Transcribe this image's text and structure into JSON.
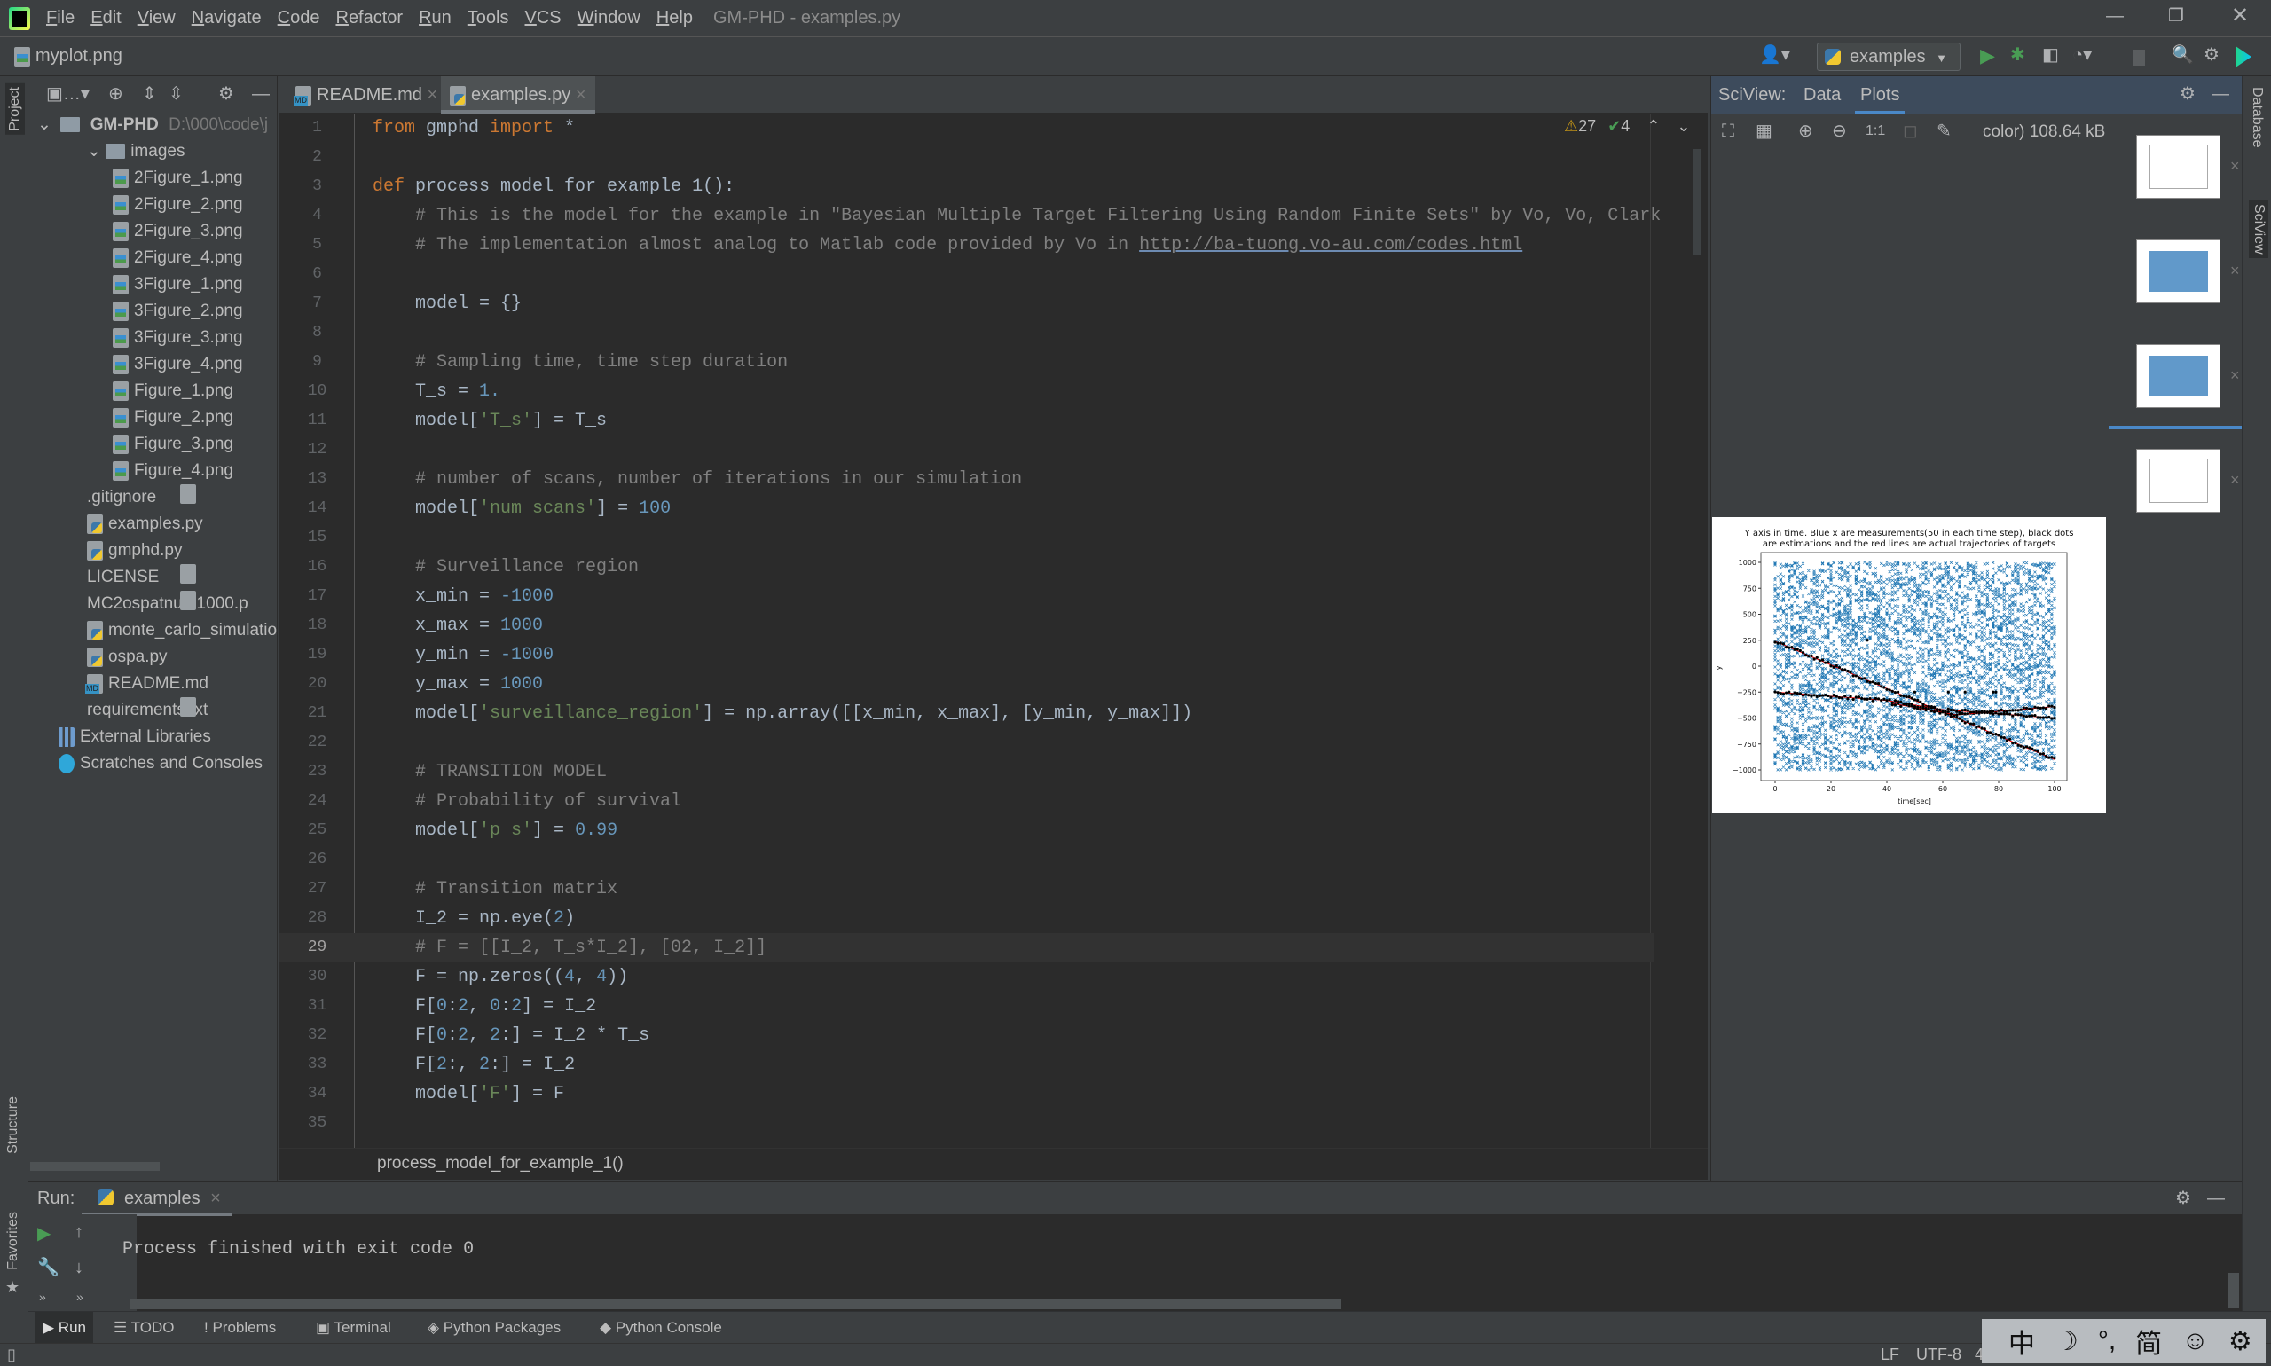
{
  "window": {
    "title": "GM-PHD - examples.py",
    "menu": [
      "File",
      "Edit",
      "View",
      "Navigate",
      "Code",
      "Refactor",
      "Run",
      "Tools",
      "VCS",
      "Window",
      "Help"
    ]
  },
  "navbar": {
    "file": "myplot.png",
    "run_config": "examples"
  },
  "left_strip": {
    "project": "Project",
    "structure": "Structure",
    "favorites": "Favorites"
  },
  "right_strip": {
    "database": "Database",
    "sciview": "SciView"
  },
  "project": {
    "root": {
      "name": "GM-PHD",
      "path": "D:\\000\\code\\j"
    },
    "items": [
      {
        "label": "images",
        "type": "folder",
        "level": 1
      },
      {
        "label": "2Figure_1.png",
        "type": "png",
        "level": 2
      },
      {
        "label": "2Figure_2.png",
        "type": "png",
        "level": 2
      },
      {
        "label": "2Figure_3.png",
        "type": "png",
        "level": 2
      },
      {
        "label": "2Figure_4.png",
        "type": "png",
        "level": 2
      },
      {
        "label": "3Figure_1.png",
        "type": "png",
        "level": 2
      },
      {
        "label": "3Figure_2.png",
        "type": "png",
        "level": 2
      },
      {
        "label": "3Figure_3.png",
        "type": "png",
        "level": 2
      },
      {
        "label": "3Figure_4.png",
        "type": "png",
        "level": 2
      },
      {
        "label": "Figure_1.png",
        "type": "png",
        "level": 2
      },
      {
        "label": "Figure_2.png",
        "type": "png",
        "level": 2
      },
      {
        "label": "Figure_3.png",
        "type": "png",
        "level": 2
      },
      {
        "label": "Figure_4.png",
        "type": "png",
        "level": 2
      },
      {
        "label": ".gitignore",
        "type": "txt",
        "level": 1
      },
      {
        "label": "examples.py",
        "type": "py",
        "level": 1
      },
      {
        "label": "gmphd.py",
        "type": "py",
        "level": 1
      },
      {
        "label": "LICENSE",
        "type": "txt",
        "level": 1
      },
      {
        "label": "MC2ospatnum1000.p",
        "type": "txt",
        "level": 1
      },
      {
        "label": "monte_carlo_simulatio",
        "type": "py",
        "level": 1
      },
      {
        "label": "ospa.py",
        "type": "py",
        "level": 1
      },
      {
        "label": "README.md",
        "type": "md",
        "level": 1
      },
      {
        "label": "requirements.txt",
        "type": "txt",
        "level": 1
      },
      {
        "label": "External Libraries",
        "type": "lib",
        "level": 0
      },
      {
        "label": "Scratches and Consoles",
        "type": "scratch",
        "level": 0
      }
    ]
  },
  "editor": {
    "tabs": [
      {
        "label": "README.md",
        "icon": "md",
        "active": false
      },
      {
        "label": "examples.py",
        "icon": "py",
        "active": true
      }
    ],
    "inspections": {
      "warnings": "27",
      "weak_warnings": "4"
    },
    "current_line": 29,
    "lines": [
      [
        [
          "k",
          "from "
        ],
        [
          "d",
          "gmphd "
        ],
        [
          "k",
          "import "
        ],
        [
          "d",
          "*"
        ]
      ],
      [],
      [
        [
          "k",
          "def "
        ],
        [
          "d",
          "process_model_for_example_1():"
        ]
      ],
      [
        [
          "c",
          "    # This is the model for the example in \"Bayesian Multiple Target Filtering Using Random Finite Sets\" by Vo, Vo, Clark"
        ]
      ],
      [
        [
          "c",
          "    # The implementation almost analog to Matlab code provided by Vo in "
        ],
        [
          "u",
          "http://ba-tuong.vo-au.com/codes.html"
        ]
      ],
      [],
      [
        [
          "d",
          "    model = {}"
        ]
      ],
      [],
      [
        [
          "c",
          "    # Sampling time, time step duration"
        ]
      ],
      [
        [
          "d",
          "    T_s = "
        ],
        [
          "n",
          "1."
        ]
      ],
      [
        [
          "d",
          "    model["
        ],
        [
          "s",
          "'T_s'"
        ],
        [
          "d",
          "] = T_s"
        ]
      ],
      [],
      [
        [
          "c",
          "    # number of scans, number of iterations in our simulation"
        ]
      ],
      [
        [
          "d",
          "    model["
        ],
        [
          "s",
          "'num_scans'"
        ],
        [
          "d",
          "] = "
        ],
        [
          "n",
          "100"
        ]
      ],
      [],
      [
        [
          "c",
          "    # Surveillance region"
        ]
      ],
      [
        [
          "d",
          "    x_min = "
        ],
        [
          "n",
          "-1000"
        ]
      ],
      [
        [
          "d",
          "    x_max = "
        ],
        [
          "n",
          "1000"
        ]
      ],
      [
        [
          "d",
          "    y_min = "
        ],
        [
          "n",
          "-1000"
        ]
      ],
      [
        [
          "d",
          "    y_max = "
        ],
        [
          "n",
          "1000"
        ]
      ],
      [
        [
          "d",
          "    model["
        ],
        [
          "s",
          "'surveillance_region'"
        ],
        [
          "d",
          "] = np.array([[x_min, x_max], [y_min, y_max]])"
        ]
      ],
      [],
      [
        [
          "c",
          "    # TRANSITION MODEL"
        ]
      ],
      [
        [
          "c",
          "    # Probability of survival"
        ]
      ],
      [
        [
          "d",
          "    model["
        ],
        [
          "s",
          "'p_s'"
        ],
        [
          "d",
          "] = "
        ],
        [
          "n",
          "0.99"
        ]
      ],
      [],
      [
        [
          "c",
          "    # Transition matrix"
        ]
      ],
      [
        [
          "d",
          "    I_2 = np.eye("
        ],
        [
          "n",
          "2"
        ],
        [
          "d",
          ")"
        ]
      ],
      [
        [
          "c",
          "    # F = [[I_2, T_s*I_2], [02, I_2]]"
        ]
      ],
      [
        [
          "d",
          "    F = np.zeros(("
        ],
        [
          "n",
          "4"
        ],
        [
          "d",
          ", "
        ],
        [
          "n",
          "4"
        ],
        [
          "d",
          "))"
        ]
      ],
      [
        [
          "d",
          "    F["
        ],
        [
          "n",
          "0"
        ],
        [
          "d",
          ":"
        ],
        [
          "n",
          "2"
        ],
        [
          "d",
          ", "
        ],
        [
          "n",
          "0"
        ],
        [
          "d",
          ":"
        ],
        [
          "n",
          "2"
        ],
        [
          "d",
          "] = I_2"
        ]
      ],
      [
        [
          "d",
          "    F["
        ],
        [
          "n",
          "0"
        ],
        [
          "d",
          ":"
        ],
        [
          "n",
          "2"
        ],
        [
          "d",
          ", "
        ],
        [
          "n",
          "2"
        ],
        [
          "d",
          ":] = I_2 * T_s"
        ]
      ],
      [
        [
          "d",
          "    F["
        ],
        [
          "n",
          "2"
        ],
        [
          "d",
          ":, "
        ],
        [
          "n",
          "2"
        ],
        [
          "d",
          ":] = I_2"
        ]
      ],
      [
        [
          "d",
          "    model["
        ],
        [
          "s",
          "'F'"
        ],
        [
          "d",
          "] = F"
        ]
      ],
      []
    ],
    "breadcrumb": "process_model_for_example_1()",
    "colors": {
      "keyword": "#cc7832",
      "comment": "#808080",
      "string": "#6a8759",
      "number": "#6897bb",
      "text": "#a9b7c6",
      "background": "#2b2b2b"
    }
  },
  "sciview": {
    "label": "SciView:",
    "tabs": [
      {
        "label": "Data",
        "active": false
      },
      {
        "label": "Plots",
        "active": true
      }
    ],
    "image_info": "color) 108.64 kB",
    "thumbnail_count": 4,
    "selected_thumbnail": 3
  },
  "chart_data": {
    "type": "scatter",
    "title": "Y axis in time. Blue x are measurements(50 in each time step), black dots\nare estimations and the red lines are actual trajectories of targets",
    "title_lines": [
      "Y axis in time. Blue x are measurements(50 in each time step), black dots",
      "are estimations and the red lines are actual trajectories of targets"
    ],
    "xlabel": "time[sec]",
    "ylabel": "y",
    "xlim": [
      -2,
      102
    ],
    "ylim": [
      -1100,
      1100
    ],
    "xticks": [
      0,
      20,
      40,
      60,
      80,
      100
    ],
    "yticks": [
      1000,
      750,
      500,
      250,
      0,
      -250,
      -500,
      -750,
      -1000
    ],
    "ytick_labels": [
      "1000",
      "750",
      "500",
      "250",
      "0",
      "−250",
      "−500",
      "−750",
      "−1000"
    ],
    "grid": false,
    "measurements": {
      "marker": "x",
      "color": "#1f77b4",
      "per_step": 50,
      "x_range": [
        0,
        100
      ],
      "y_range": [
        -1000,
        1000
      ]
    },
    "true_trajectories": {
      "color": "#ff0000",
      "lines": [
        {
          "x": [
            0,
            100
          ],
          "y": [
            240,
            -900
          ]
        },
        {
          "x": [
            0,
            40,
            60,
            100
          ],
          "y": [
            -250,
            -330,
            -420,
            -500
          ]
        },
        {
          "x": [
            42,
            65,
            100
          ],
          "y": [
            -360,
            -470,
            -390
          ]
        }
      ]
    },
    "estimates": {
      "color": "#000000",
      "clutter_points": [
        [
          33,
          250
        ],
        [
          50,
          -250
        ],
        [
          62,
          -250
        ],
        [
          68,
          -250
        ],
        [
          78,
          -250
        ],
        [
          79,
          -250
        ]
      ]
    }
  },
  "run": {
    "label": "Run:",
    "tab": "examples",
    "output": "Process finished with exit code 0"
  },
  "tool_windows": [
    "Run",
    "TODO",
    "Problems",
    "Terminal",
    "Python Packages",
    "Python Console"
  ],
  "status": {
    "line_sep": "LF",
    "encoding": "UTF-8",
    "indent": "4"
  },
  "ime": {
    "items": [
      "中",
      "☽",
      "°,",
      "简",
      "☺",
      "⚙"
    ]
  }
}
